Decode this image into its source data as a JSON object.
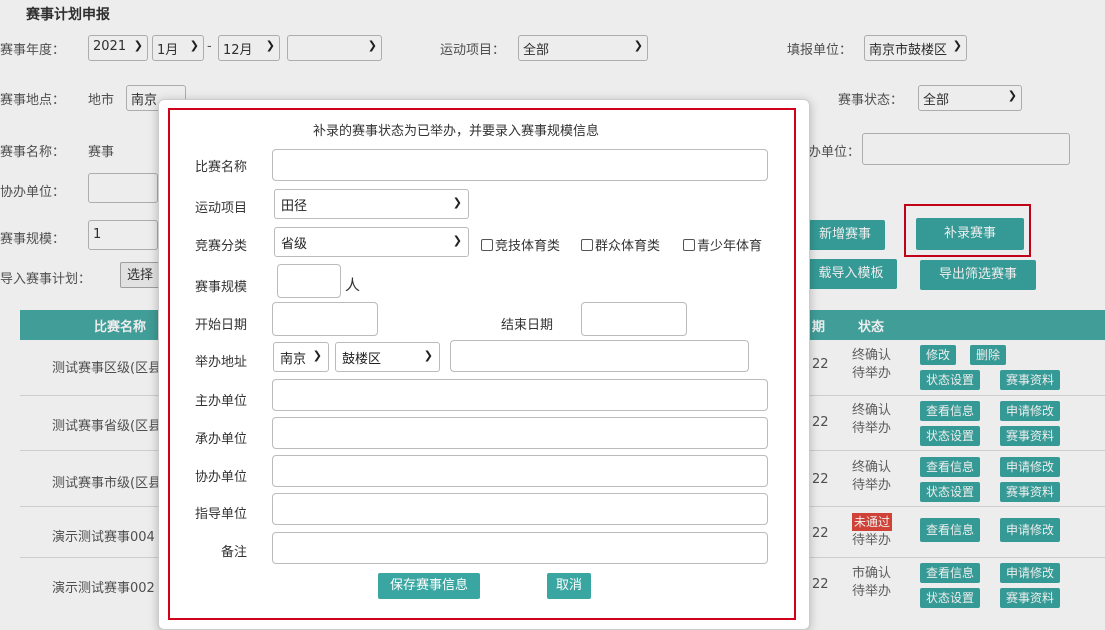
{
  "page": {
    "title": "赛事计划申报"
  },
  "filters": {
    "year_label": "赛事年度：",
    "year": "2021",
    "month_start": "1月",
    "month_sep": "-",
    "month_end": "12月",
    "extra_select": "",
    "sport_label": "运动项目：",
    "sport": "全部",
    "unit_label": "填报单位：",
    "unit": "南京市鼓楼区",
    "location_label": "赛事地点：",
    "location_city_label": "地市",
    "location_city": "南京",
    "status_label": "赛事状态：",
    "status": "全部",
    "name_label": "赛事名称：",
    "name_value": "赛事",
    "organizer_label": "办单位：",
    "co_label": "协办单位：",
    "scale_label": "赛事规模：",
    "scale_value": "1",
    "import_label": "导入赛事计划：",
    "import_button": "选择"
  },
  "actions": {
    "add": "新增赛事",
    "supplement": "补录赛事",
    "download_template": "载导入模板",
    "export": "导出筛选赛事"
  },
  "table": {
    "headers": {
      "name": "比赛名称",
      "date_tail": "期",
      "status": "状态"
    },
    "rows": [
      {
        "name": "测试赛事区级(区县",
        "date": "22",
        "status1": "终确认",
        "status2": "待举办",
        "ops": [
          "修改",
          "删除",
          "状态设置",
          "赛事资料"
        ]
      },
      {
        "name": "测试赛事省级(区县",
        "date": "22",
        "status1": "终确认",
        "status2": "待举办",
        "ops": [
          "查看信息",
          "申请修改",
          "状态设置",
          "赛事资料"
        ]
      },
      {
        "name": "测试赛事市级(区县",
        "date": "22",
        "status1": "终确认",
        "status2": "待举办",
        "ops": [
          "查看信息",
          "申请修改",
          "状态设置",
          "赛事资料"
        ]
      },
      {
        "name": "演示测试赛事004",
        "date": "22",
        "status1": "未通过",
        "status2": "待举办",
        "ops": [
          "查看信息",
          "申请修改"
        ]
      },
      {
        "name": "演示测试赛事002",
        "date": "22",
        "status1": "市确认",
        "status2": "待举办",
        "ops": [
          "查看信息",
          "申请修改",
          "状态设置",
          "赛事资料"
        ]
      }
    ]
  },
  "modal": {
    "notice": "补录的赛事状态为已举办，并要录入赛事规模信息",
    "name_label": "比赛名称",
    "sport_label": "运动项目",
    "sport_value": "田径",
    "category_label": "竞赛分类",
    "category_value": "省级",
    "checkboxes": [
      "竞技体育类",
      "群众体育类",
      "青少年体育"
    ],
    "scale_label": "赛事规模",
    "scale_unit": "人",
    "start_label": "开始日期",
    "end_label": "结束日期",
    "address_label": "举办地址",
    "address_city": "南京",
    "address_district": "鼓楼区",
    "host_label": "主办单位",
    "undertake_label": "承办单位",
    "co_label": "协办单位",
    "guide_label": "指导单位",
    "remark_label": "备注",
    "save_button": "保存赛事信息",
    "cancel_button": "取消"
  },
  "colors": {
    "accent": "#3aa6a1",
    "highlight": "#d0021b",
    "header": "#45a9a3",
    "rejected": "#e0473c"
  },
  "icons": {
    "caret": "chevron-down-icon"
  }
}
